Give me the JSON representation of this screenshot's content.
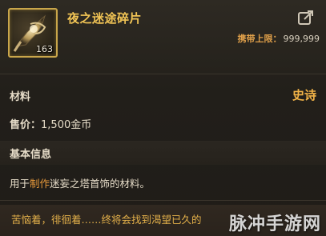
{
  "item": {
    "name": "夜之迷途碎片",
    "count": "163",
    "carry_label": "携带上限：",
    "carry_value": "999,999",
    "icon": "shard-icon"
  },
  "material": {
    "label": "材料",
    "rarity": "史诗",
    "rarity_color": "#f2b347"
  },
  "price": {
    "label": "售价：",
    "value": "1,500金币"
  },
  "info": {
    "title": "基本信息",
    "desc_prefix": "用于",
    "desc_highlight": "制作",
    "desc_suffix": "迷妄之塔首饰的材料。"
  },
  "flavor": "苦恼着，徘徊着……终将会找到渴望已久的",
  "watermark": "脉冲手游网",
  "colors": {
    "name_gold": "#f2c555",
    "carry_orange": "#e0a04a",
    "highlight_orange": "#e89a3c",
    "flavor_gold": "#e3b04a"
  }
}
